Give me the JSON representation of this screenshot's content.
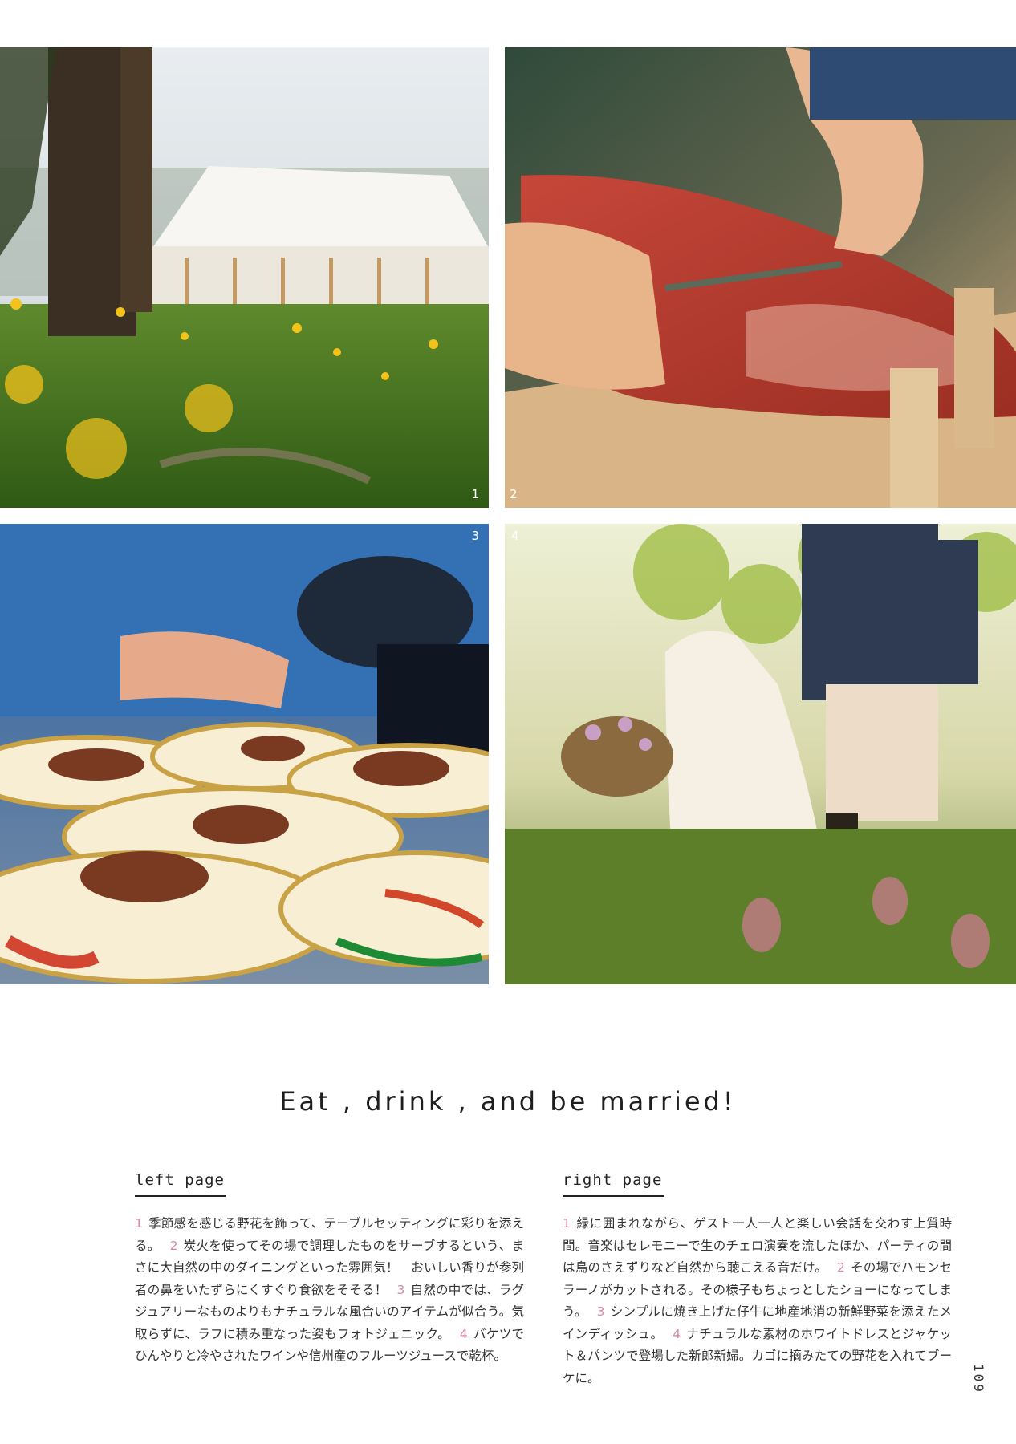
{
  "photos": [
    {
      "number": "1",
      "subject": "tent-field"
    },
    {
      "number": "2",
      "subject": "ham-carving"
    },
    {
      "number": "3",
      "subject": "plated-lamb"
    },
    {
      "number": "4",
      "subject": "bride-and-groom"
    }
  ],
  "headline": "Eat , drink , and be married!",
  "left_page": {
    "label": "left page",
    "items": [
      {
        "num": "1",
        "text": "季節感を感じる野花を飾って、テーブルセッティングに彩りを添える。"
      },
      {
        "num": "2",
        "text": "炭火を使ってその場で調理したものをサーブするという、まさに大自然の中のダイニングといった雰囲気！　おいしい香りが参列者の鼻をいたずらにくすぐり食欲をそそる！"
      },
      {
        "num": "3",
        "text": "自然の中では、ラグジュアリーなものよりもナチュラルな風合いのアイテムが似合う。気取らずに、ラフに積み重なった姿もフォトジェニック。"
      },
      {
        "num": "4",
        "text": "バケツでひんやりと冷やされたワインや信州産のフルーツジュースで乾杯。"
      }
    ]
  },
  "right_page": {
    "label": "right page",
    "items": [
      {
        "num": "1",
        "text": "緑に囲まれながら、ゲスト一人一人と楽しい会話を交わす上質時間。音楽はセレモニーで生のチェロ演奏を流したほか、パーティの間は鳥のさえずりなど自然から聴こえる音だけ。"
      },
      {
        "num": "2",
        "text": "その場でハモンセラーノがカットされる。その様子もちょっとしたショーになってしまう。"
      },
      {
        "num": "3",
        "text": "シンプルに焼き上げた仔牛に地産地消の新鮮野菜を添えたメインディッシュ。"
      },
      {
        "num": "4",
        "text": "ナチュラルな素材のホワイトドレスとジャケット＆パンツで登場した新郎新婦。カゴに摘みたての野花を入れてブーケに。"
      }
    ]
  },
  "folio": "109",
  "colors": {
    "accent_number": "#d98aa0",
    "text": "#333333"
  }
}
